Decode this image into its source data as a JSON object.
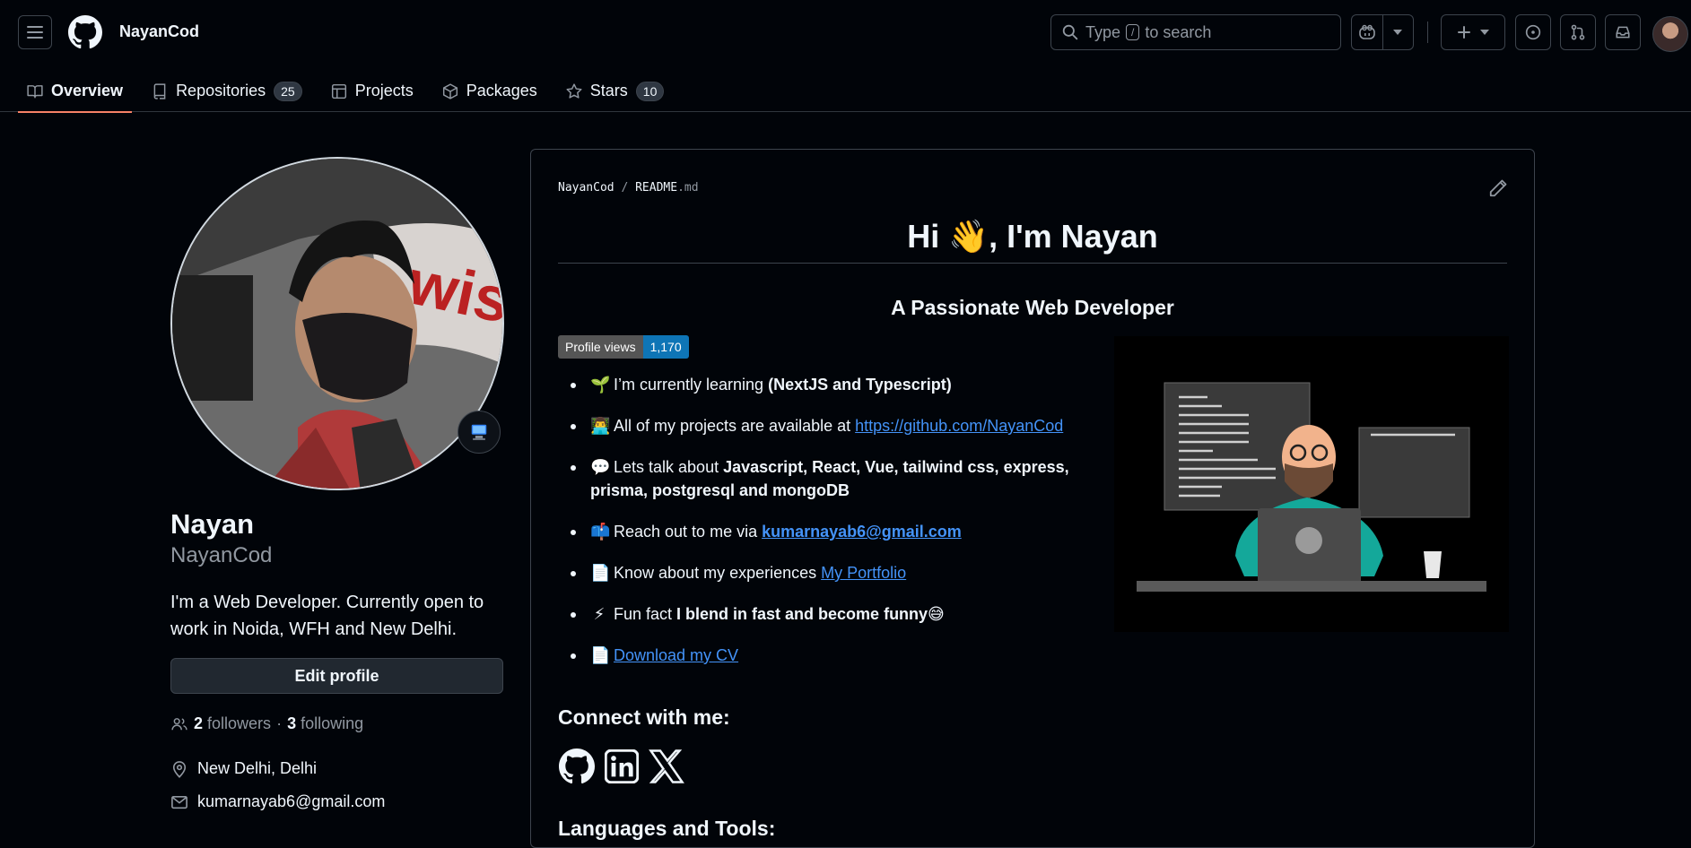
{
  "header": {
    "username": "NayanCod",
    "search_prefix": "Type",
    "search_key": "/",
    "search_suffix": "to search"
  },
  "tabs": [
    {
      "label": "Overview"
    },
    {
      "label": "Repositories",
      "count": "25"
    },
    {
      "label": "Projects"
    },
    {
      "label": "Packages"
    },
    {
      "label": "Stars",
      "count": "10"
    }
  ],
  "profile": {
    "name": "Nayan",
    "login": "NayanCod",
    "bio": "I'm a Web Developer. Currently open to work in Noida, WFH and New Delhi.",
    "edit_label": "Edit profile",
    "followers_count": "2",
    "followers_label": "followers",
    "separator": "·",
    "following_count": "3",
    "following_label": "following",
    "location": "New Delhi, Delhi",
    "email": "kumarnayab6@gmail.com"
  },
  "readme": {
    "path_owner": "NayanCod",
    "path_sep": "/",
    "path_file": "README",
    "path_ext": ".md",
    "title": "Hi 👋, I'm Nayan",
    "subtitle": "A Passionate Web Developer",
    "badge_label": "Profile views",
    "badge_value": "1,170",
    "items": [
      {
        "emoji": "🌱",
        "text": "I’m currently learning ",
        "bold": "(NextJS and Typescript)"
      },
      {
        "emoji": "👨‍💻",
        "text": "All of my projects are available at ",
        "link": "https://github.com/NayanCod"
      },
      {
        "emoji": "💬",
        "text": "Lets talk about ",
        "bold": "Javascript, React, Vue, tailwind css, express, prisma, postgresql and mongoDB"
      },
      {
        "emoji": "📫",
        "text": "Reach out to me via ",
        "link": "kumarnayab6@gmail.com"
      },
      {
        "emoji": "📄",
        "text": "Know about my experiences ",
        "link": "My Portfolio"
      },
      {
        "emoji": "⚡",
        "text": "Fun fact ",
        "bold": "I blend in fast and become funny😅"
      },
      {
        "emoji": "📄",
        "text": "",
        "link": "Download my CV"
      }
    ],
    "connect_heading": "Connect with me:",
    "langs_heading": "Languages and Tools:"
  }
}
